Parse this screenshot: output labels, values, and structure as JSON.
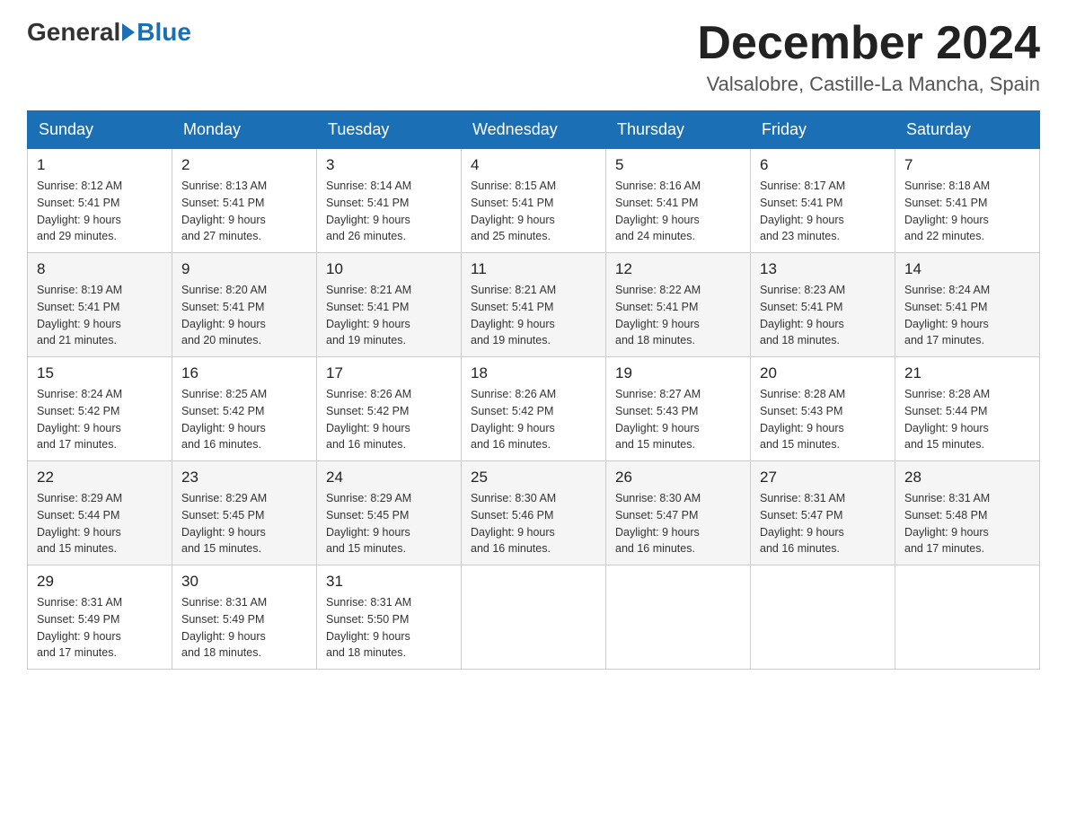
{
  "header": {
    "logo_general": "General",
    "logo_blue": "Blue",
    "month_title": "December 2024",
    "location": "Valsalobre, Castille-La Mancha, Spain"
  },
  "days_of_week": [
    "Sunday",
    "Monday",
    "Tuesday",
    "Wednesday",
    "Thursday",
    "Friday",
    "Saturday"
  ],
  "weeks": [
    [
      {
        "day": "1",
        "sunrise": "8:12 AM",
        "sunset": "5:41 PM",
        "daylight": "9 hours and 29 minutes."
      },
      {
        "day": "2",
        "sunrise": "8:13 AM",
        "sunset": "5:41 PM",
        "daylight": "9 hours and 27 minutes."
      },
      {
        "day": "3",
        "sunrise": "8:14 AM",
        "sunset": "5:41 PM",
        "daylight": "9 hours and 26 minutes."
      },
      {
        "day": "4",
        "sunrise": "8:15 AM",
        "sunset": "5:41 PM",
        "daylight": "9 hours and 25 minutes."
      },
      {
        "day": "5",
        "sunrise": "8:16 AM",
        "sunset": "5:41 PM",
        "daylight": "9 hours and 24 minutes."
      },
      {
        "day": "6",
        "sunrise": "8:17 AM",
        "sunset": "5:41 PM",
        "daylight": "9 hours and 23 minutes."
      },
      {
        "day": "7",
        "sunrise": "8:18 AM",
        "sunset": "5:41 PM",
        "daylight": "9 hours and 22 minutes."
      }
    ],
    [
      {
        "day": "8",
        "sunrise": "8:19 AM",
        "sunset": "5:41 PM",
        "daylight": "9 hours and 21 minutes."
      },
      {
        "day": "9",
        "sunrise": "8:20 AM",
        "sunset": "5:41 PM",
        "daylight": "9 hours and 20 minutes."
      },
      {
        "day": "10",
        "sunrise": "8:21 AM",
        "sunset": "5:41 PM",
        "daylight": "9 hours and 19 minutes."
      },
      {
        "day": "11",
        "sunrise": "8:21 AM",
        "sunset": "5:41 PM",
        "daylight": "9 hours and 19 minutes."
      },
      {
        "day": "12",
        "sunrise": "8:22 AM",
        "sunset": "5:41 PM",
        "daylight": "9 hours and 18 minutes."
      },
      {
        "day": "13",
        "sunrise": "8:23 AM",
        "sunset": "5:41 PM",
        "daylight": "9 hours and 18 minutes."
      },
      {
        "day": "14",
        "sunrise": "8:24 AM",
        "sunset": "5:41 PM",
        "daylight": "9 hours and 17 minutes."
      }
    ],
    [
      {
        "day": "15",
        "sunrise": "8:24 AM",
        "sunset": "5:42 PM",
        "daylight": "9 hours and 17 minutes."
      },
      {
        "day": "16",
        "sunrise": "8:25 AM",
        "sunset": "5:42 PM",
        "daylight": "9 hours and 16 minutes."
      },
      {
        "day": "17",
        "sunrise": "8:26 AM",
        "sunset": "5:42 PM",
        "daylight": "9 hours and 16 minutes."
      },
      {
        "day": "18",
        "sunrise": "8:26 AM",
        "sunset": "5:42 PM",
        "daylight": "9 hours and 16 minutes."
      },
      {
        "day": "19",
        "sunrise": "8:27 AM",
        "sunset": "5:43 PM",
        "daylight": "9 hours and 15 minutes."
      },
      {
        "day": "20",
        "sunrise": "8:28 AM",
        "sunset": "5:43 PM",
        "daylight": "9 hours and 15 minutes."
      },
      {
        "day": "21",
        "sunrise": "8:28 AM",
        "sunset": "5:44 PM",
        "daylight": "9 hours and 15 minutes."
      }
    ],
    [
      {
        "day": "22",
        "sunrise": "8:29 AM",
        "sunset": "5:44 PM",
        "daylight": "9 hours and 15 minutes."
      },
      {
        "day": "23",
        "sunrise": "8:29 AM",
        "sunset": "5:45 PM",
        "daylight": "9 hours and 15 minutes."
      },
      {
        "day": "24",
        "sunrise": "8:29 AM",
        "sunset": "5:45 PM",
        "daylight": "9 hours and 15 minutes."
      },
      {
        "day": "25",
        "sunrise": "8:30 AM",
        "sunset": "5:46 PM",
        "daylight": "9 hours and 16 minutes."
      },
      {
        "day": "26",
        "sunrise": "8:30 AM",
        "sunset": "5:47 PM",
        "daylight": "9 hours and 16 minutes."
      },
      {
        "day": "27",
        "sunrise": "8:31 AM",
        "sunset": "5:47 PM",
        "daylight": "9 hours and 16 minutes."
      },
      {
        "day": "28",
        "sunrise": "8:31 AM",
        "sunset": "5:48 PM",
        "daylight": "9 hours and 17 minutes."
      }
    ],
    [
      {
        "day": "29",
        "sunrise": "8:31 AM",
        "sunset": "5:49 PM",
        "daylight": "9 hours and 17 minutes."
      },
      {
        "day": "30",
        "sunrise": "8:31 AM",
        "sunset": "5:49 PM",
        "daylight": "9 hours and 18 minutes."
      },
      {
        "day": "31",
        "sunrise": "8:31 AM",
        "sunset": "5:50 PM",
        "daylight": "9 hours and 18 minutes."
      },
      null,
      null,
      null,
      null
    ]
  ]
}
